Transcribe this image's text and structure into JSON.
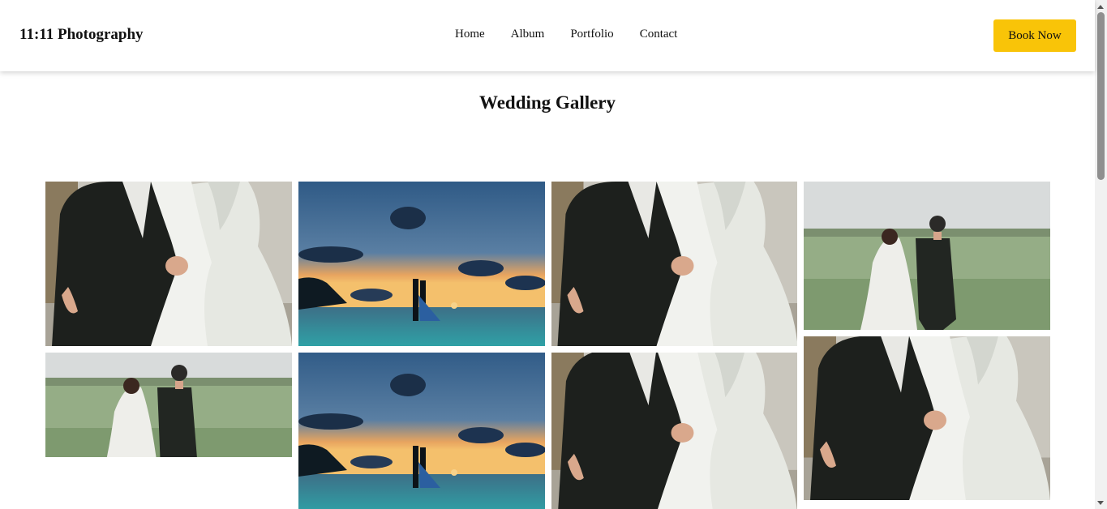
{
  "nav": {
    "brand": "11:11 Photography",
    "links": [
      "Home",
      "Album",
      "Portfolio",
      "Contact"
    ],
    "cta": "Book Now",
    "accent_color": "#f9c408"
  },
  "gallery": {
    "title": "Wedding Gallery",
    "photos": [
      {
        "subject": "couple-holding-hands"
      },
      {
        "subject": "sunset-beach-kiss"
      },
      {
        "subject": "couple-holding-hands"
      },
      {
        "subject": "couple-walking-field"
      },
      {
        "subject": "couple-walking-field"
      },
      {
        "subject": "sunset-beach-kiss"
      },
      {
        "subject": "couple-holding-hands"
      },
      {
        "subject": "couple-holding-hands"
      }
    ]
  }
}
